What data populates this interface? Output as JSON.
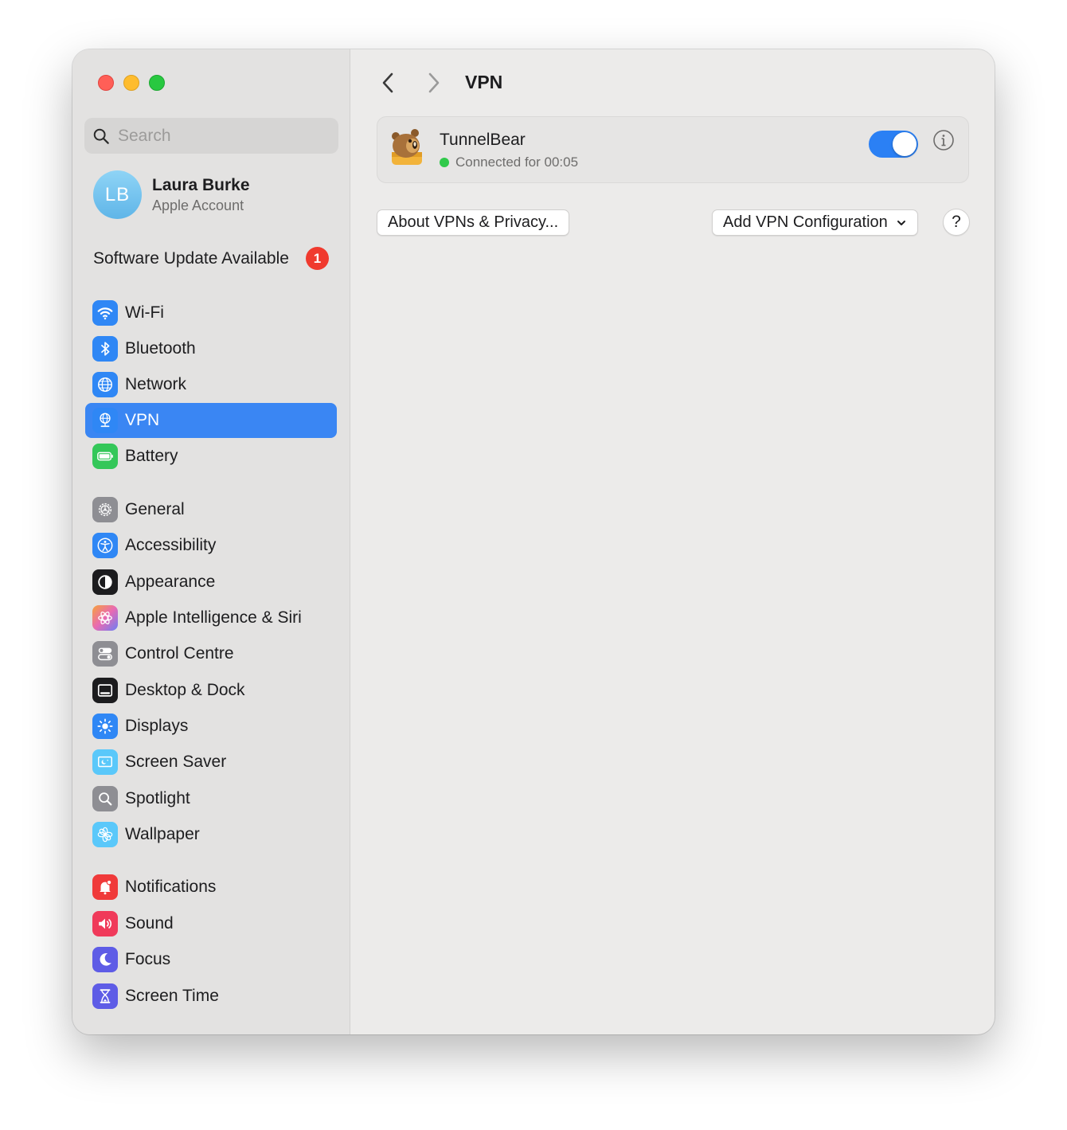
{
  "window": {
    "traffic_lights": [
      "close",
      "minimize",
      "zoom"
    ]
  },
  "sidebar": {
    "search_placeholder": "Search",
    "account": {
      "initials": "LB",
      "name": "Laura Burke",
      "subtitle": "Apple Account"
    },
    "software_update": {
      "label": "Software Update Available",
      "badge": "1"
    },
    "items": [
      {
        "id": "wifi",
        "label": "Wi-Fi",
        "icon": "wifi-icon",
        "color": "#2f87f5"
      },
      {
        "id": "bluetooth",
        "label": "Bluetooth",
        "icon": "bluetooth-icon",
        "color": "#2f87f5"
      },
      {
        "id": "network",
        "label": "Network",
        "icon": "globe-icon",
        "color": "#2f87f5"
      },
      {
        "id": "vpn",
        "label": "VPN",
        "icon": "vpn-globe-icon",
        "color": "#2f87f5",
        "active": true
      },
      {
        "id": "battery",
        "label": "Battery",
        "icon": "battery-icon",
        "color": "#34c759"
      },
      {
        "id": "general",
        "label": "General",
        "icon": "gear-icon",
        "color": "#8e8e93"
      },
      {
        "id": "accessibility",
        "label": "Accessibility",
        "icon": "accessibility-icon",
        "color": "#2f87f5"
      },
      {
        "id": "appearance",
        "label": "Appearance",
        "icon": "appearance-icon",
        "color": "#1c1c1e"
      },
      {
        "id": "apple-intelligence",
        "label": "Apple Intelligence & Siri",
        "icon": "siri-icon",
        "color": "#e86ab3"
      },
      {
        "id": "control-centre",
        "label": "Control Centre",
        "icon": "control-centre-icon",
        "color": "#8e8e93"
      },
      {
        "id": "desktop-dock",
        "label": "Desktop & Dock",
        "icon": "dock-icon",
        "color": "#1c1c1e"
      },
      {
        "id": "displays",
        "label": "Displays",
        "icon": "sun-icon",
        "color": "#2f87f5"
      },
      {
        "id": "screen-saver",
        "label": "Screen Saver",
        "icon": "screen-saver-icon",
        "color": "#5ac8fa"
      },
      {
        "id": "spotlight",
        "label": "Spotlight",
        "icon": "magnifier-icon",
        "color": "#8e8e93"
      },
      {
        "id": "wallpaper",
        "label": "Wallpaper",
        "icon": "flower-icon",
        "color": "#5ac8fa"
      },
      {
        "id": "notifications",
        "label": "Notifications",
        "icon": "bell-icon",
        "color": "#f03a3a"
      },
      {
        "id": "sound",
        "label": "Sound",
        "icon": "speaker-icon",
        "color": "#f03a5a"
      },
      {
        "id": "focus",
        "label": "Focus",
        "icon": "moon-icon",
        "color": "#5e5ce6"
      },
      {
        "id": "screen-time",
        "label": "Screen Time",
        "icon": "hourglass-icon",
        "color": "#5e5ce6"
      }
    ]
  },
  "main": {
    "title": "VPN",
    "vpn": {
      "name": "TunnelBear",
      "status": "Connected for 00:05",
      "enabled": true,
      "status_color": "#30c94a"
    },
    "buttons": {
      "about": "About VPNs & Privacy...",
      "add": "Add VPN Configuration",
      "help": "?"
    }
  },
  "colors": {
    "accent": "#3a86f3",
    "badge": "#f03a2e"
  }
}
